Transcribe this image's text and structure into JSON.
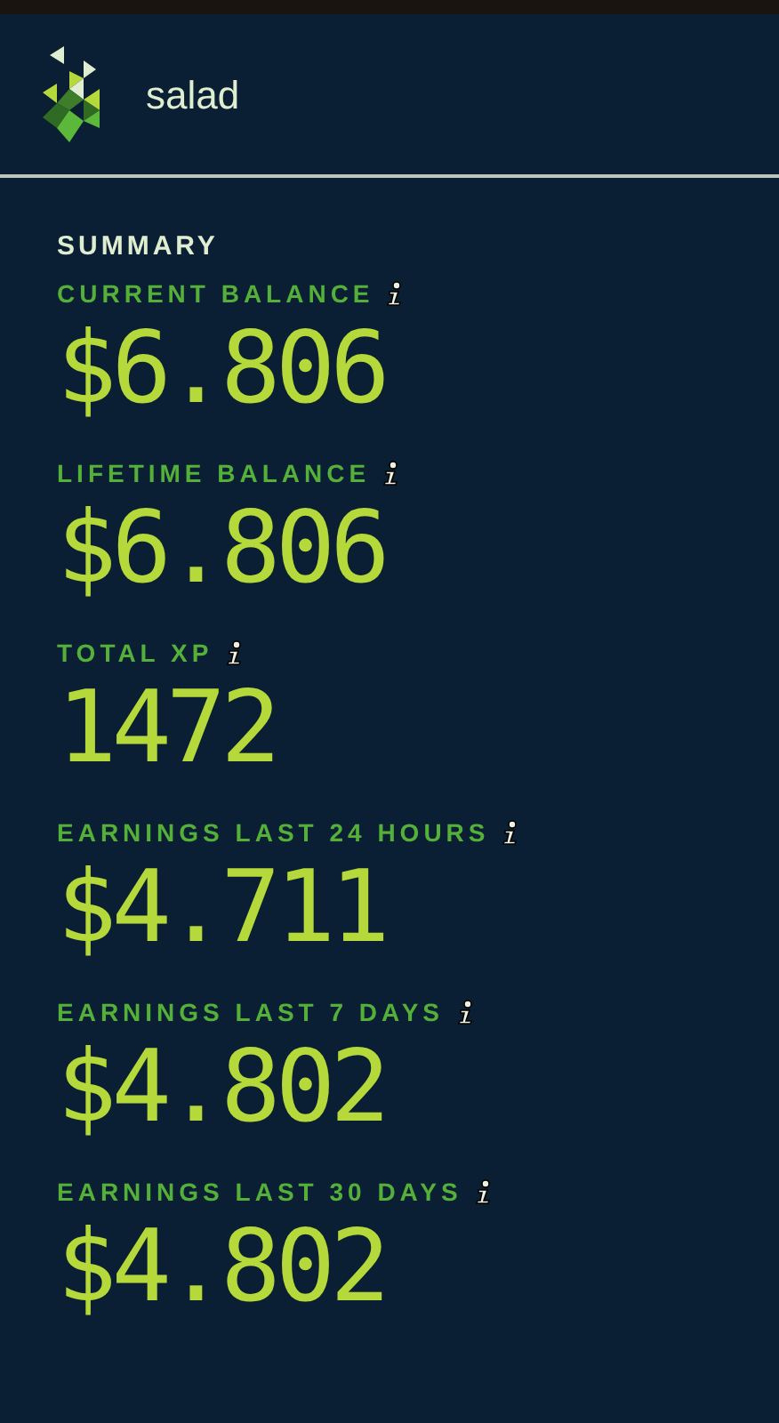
{
  "brand": {
    "name": "salad"
  },
  "summary": {
    "title": "SUMMARY",
    "stats": [
      {
        "label": "CURRENT BALANCE",
        "value": "$6.806"
      },
      {
        "label": "LIFETIME BALANCE",
        "value": "$6.806"
      },
      {
        "label": "TOTAL XP",
        "value": "1472"
      },
      {
        "label": "EARNINGS LAST 24 HOURS",
        "value": "$4.711"
      },
      {
        "label": "EARNINGS LAST 7 DAYS",
        "value": "$4.802"
      },
      {
        "label": "EARNINGS LAST 30 DAYS",
        "value": "$4.802"
      }
    ]
  }
}
